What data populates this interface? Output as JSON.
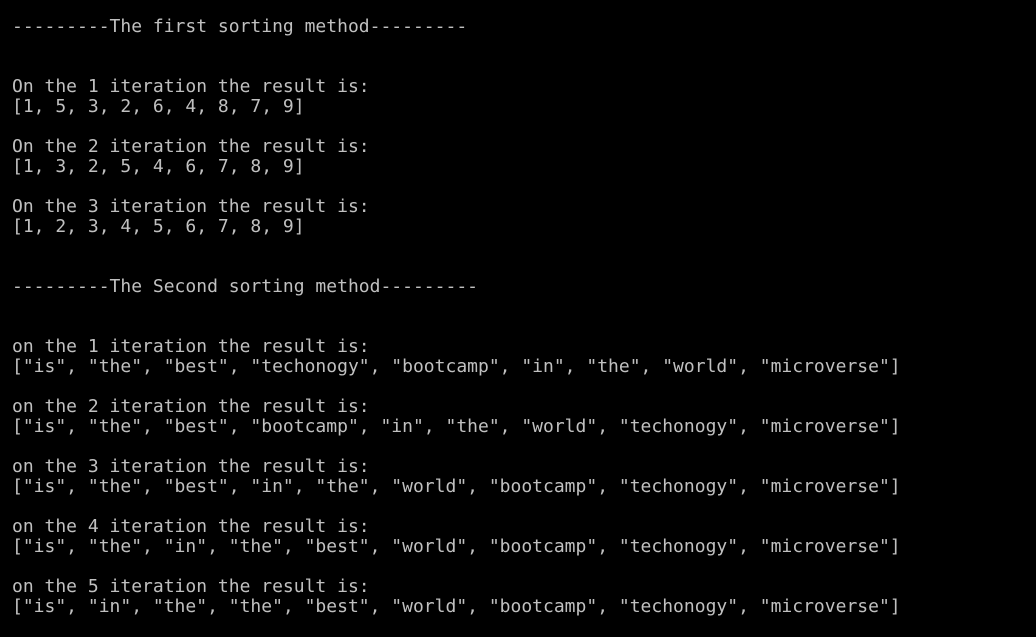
{
  "terminal": {
    "text_color": "#c0c0c0",
    "background_color": "#000000",
    "section1": {
      "header": "---------The first sorting method---------",
      "iterations": [
        {
          "label": "On the 1 iteration the result is:",
          "result": "[1, 5, 3, 2, 6, 4, 8, 7, 9]"
        },
        {
          "label": "On the 2 iteration the result is:",
          "result": "[1, 3, 2, 5, 4, 6, 7, 8, 9]"
        },
        {
          "label": "On the 3 iteration the result is:",
          "result": "[1, 2, 3, 4, 5, 6, 7, 8, 9]"
        }
      ]
    },
    "section2": {
      "header": "---------The Second sorting method---------",
      "iterations": [
        {
          "label": "on the 1 iteration the result is:",
          "result": "[\"is\", \"the\", \"best\", \"techonogy\", \"bootcamp\", \"in\", \"the\", \"world\", \"microverse\"]"
        },
        {
          "label": "on the 2 iteration the result is:",
          "result": "[\"is\", \"the\", \"best\", \"bootcamp\", \"in\", \"the\", \"world\", \"techonogy\", \"microverse\"]"
        },
        {
          "label": "on the 3 iteration the result is:",
          "result": "[\"is\", \"the\", \"best\", \"in\", \"the\", \"world\", \"bootcamp\", \"techonogy\", \"microverse\"]"
        },
        {
          "label": "on the 4 iteration the result is:",
          "result": "[\"is\", \"the\", \"in\", \"the\", \"best\", \"world\", \"bootcamp\", \"techonogy\", \"microverse\"]"
        },
        {
          "label": "on the 5 iteration the result is:",
          "result": "[\"is\", \"in\", \"the\", \"the\", \"best\", \"world\", \"bootcamp\", \"techonogy\", \"microverse\"]"
        }
      ]
    }
  }
}
